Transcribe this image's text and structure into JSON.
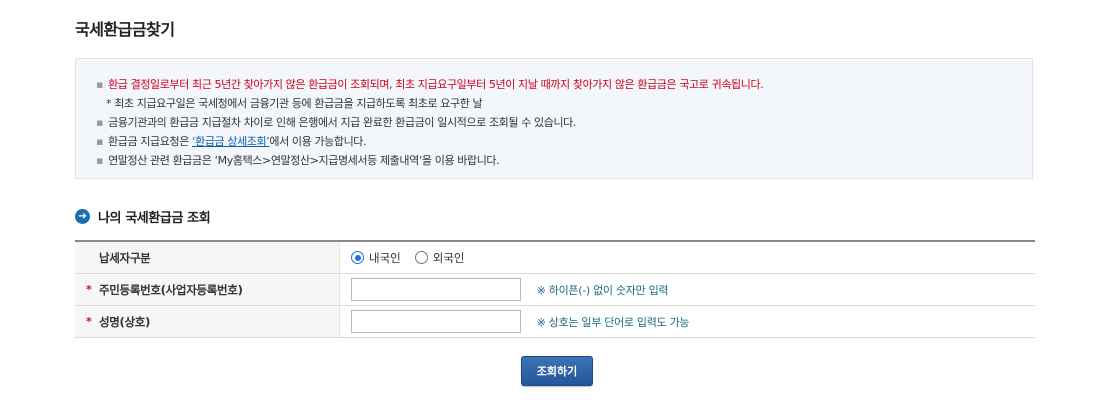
{
  "page": {
    "title": "국세환급금찾기"
  },
  "notice": {
    "line1": "환급 결정일로부터 최근 5년간 찾아가지 않은 환급금이 조회되며, 최초 지급요구일부터 5년이 지날 때까지 찾아가지 않은 환급금은 국고로 귀속됩니다.",
    "line1_sub": "* 최초 지급요구일은 국세청에서 금융기관 등에 환급금을 지급하도록 최초로 요구한 날",
    "line2": "금융기관과의 환급금 지급절차 차이로 인해 은행에서 지급 완료한 환급금이 일시적으로 조회될 수 있습니다.",
    "line3_prefix": "환급금 지급요청은 ",
    "line3_link": "‘환급금 상세조회’",
    "line3_suffix": "에서 이용 가능합니다.",
    "line4": "연말정산 관련 환급금은 ‘My홈택스>연말정산>지급명세서등 제출내역’을 이용 바랍니다."
  },
  "section": {
    "title": "나의 국세환급금 조회"
  },
  "form": {
    "taxpayer_type_label": "납세자구분",
    "radio_domestic": "내국인",
    "radio_foreign": "외국인",
    "id_label": "주민등록번호(사업자등록번호)",
    "id_value": "",
    "id_hint": "※ 하이픈(-) 없이 숫자만 입력",
    "name_label": "성명(상호)",
    "name_value": "",
    "name_hint": "※ 상호는 일부 단어로 입력도 가능",
    "required_mark": "*"
  },
  "buttons": {
    "search": "조회하기"
  },
  "colors": {
    "accent": "#1e6fb0",
    "warning": "#d0021b",
    "hint": "#1b6a84"
  }
}
